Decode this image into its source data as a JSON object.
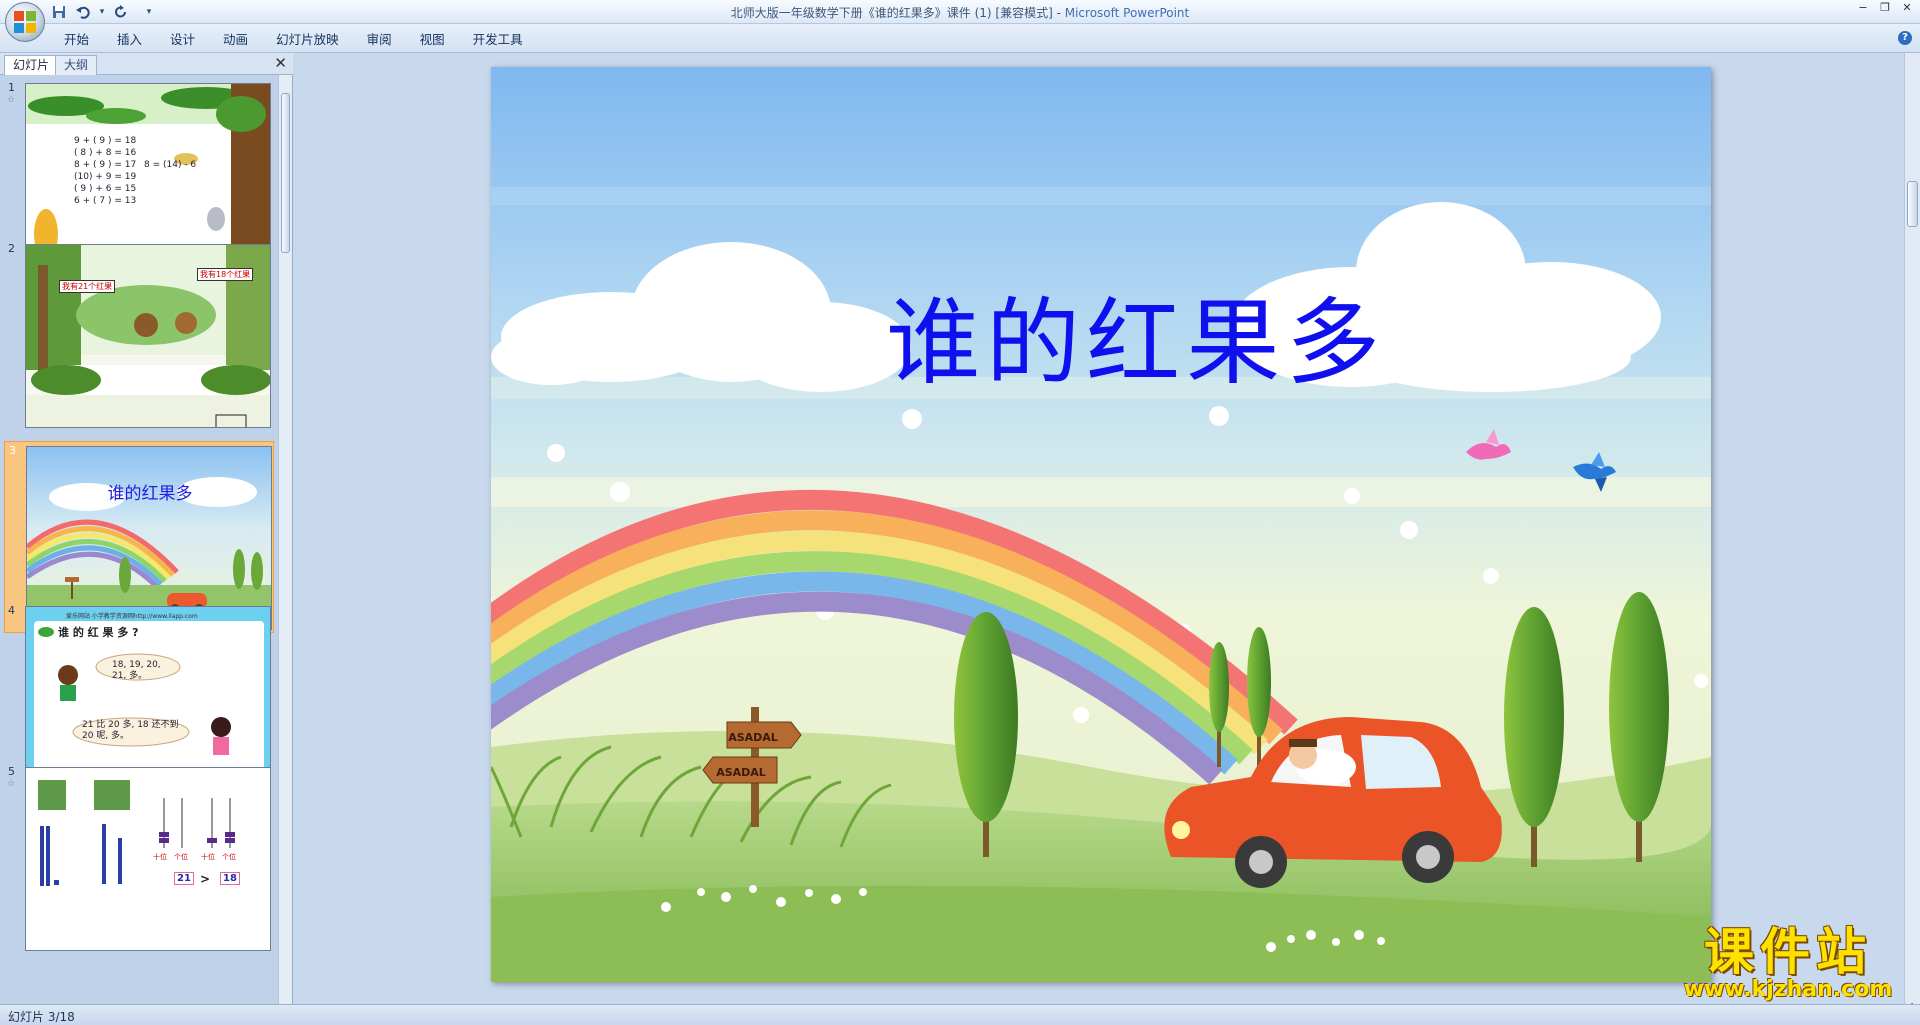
{
  "window": {
    "title": "北师大版一年级数学下册《谁的红果多》课件 (1) [兼容模式]",
    "app_name": "Microsoft PowerPoint",
    "separator": " - "
  },
  "quick_access": [
    {
      "icon": "save-icon",
      "glyph": "💾"
    },
    {
      "icon": "undo-icon",
      "glyph": "↶"
    },
    {
      "icon": "dropdown-icon",
      "glyph": "▾"
    },
    {
      "icon": "redo-icon",
      "glyph": "↻"
    },
    {
      "icon": "customize-icon",
      "glyph": "▾"
    }
  ],
  "ribbon": {
    "tabs": [
      "开始",
      "插入",
      "设计",
      "动画",
      "幻灯片放映",
      "审阅",
      "视图",
      "开发工具"
    ],
    "help_glyph": "?"
  },
  "left_panel": {
    "tab_slides": "幻灯片",
    "tab_outline": "大纲",
    "close_glyph": "✕"
  },
  "thumbnails": [
    {
      "number": "1",
      "equations_left": [
        "9 + ( 9 ) = 18",
        "( 8 ) + 8 = 16",
        "8 + ( 9 ) = 17",
        "(10) + 9 = 19",
        "( 9 ) + 6 = 15",
        "6 + ( 7 ) = 13"
      ],
      "equation_right": "8 = (14) - 6"
    },
    {
      "number": "2",
      "left_bubble": "我有21个红果",
      "right_bubble": "我有18个红果"
    },
    {
      "number": "3",
      "title": "谁的红果多"
    },
    {
      "number": "4",
      "header": "谁 的 红 果 多 ?",
      "top_text": "爱乐网站 小学教学资源网http://www.ilapp.com",
      "bubble1": "18, 19, 20, 21, 多。",
      "bubble2": "21 比 20 多, 18 还不到 20 呢, 多。"
    },
    {
      "number": "5",
      "value_left": "21",
      "compare": ">",
      "value_right": "18",
      "abacus_labels": [
        "十位",
        "个位",
        "十位",
        "个位"
      ]
    }
  ],
  "slide": {
    "title": "谁的红果多",
    "sign_top": "ASADAL",
    "sign_bottom": "ASADAL"
  },
  "status_bar": {
    "slide_indicator": "幻灯片 3/18"
  },
  "watermark": {
    "main": "课件站",
    "url": "www.kjzhan.com"
  },
  "colors": {
    "title_blue": "#1010ee",
    "active_thumb": "#f9c682",
    "ribbon_bg": "#d4e2f3",
    "workspace_bg": "#c8d9ed",
    "watermark_yellow": "#ffe100"
  }
}
